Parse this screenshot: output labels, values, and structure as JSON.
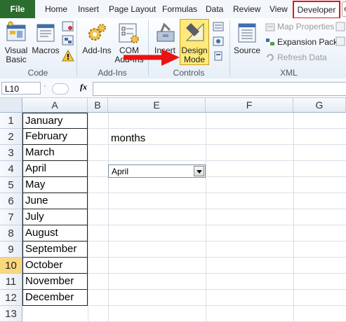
{
  "tabs": {
    "file": "File",
    "home": "Home",
    "insert": "Insert",
    "page_layout": "Page Layout",
    "formulas": "Formulas",
    "data": "Data",
    "review": "Review",
    "view": "View",
    "developer": "Developer",
    "more": "ꞓ"
  },
  "ribbon": {
    "code": {
      "visual_basic_1": "Visual",
      "visual_basic_2": "Basic",
      "macros": "Macros",
      "group": "Code"
    },
    "addins": {
      "addins": "Add-Ins",
      "com_1": "COM",
      "com_2": "Add-Ins",
      "group": "Add-Ins"
    },
    "controls": {
      "insert": "Insert",
      "design_1": "Design",
      "design_2": "Mode",
      "group": "Controls"
    },
    "xml": {
      "source": "Source",
      "map_properties": "Map Properties",
      "expansion_packs": "Expansion Packs",
      "refresh_data": "Refresh Data",
      "group": "XML"
    }
  },
  "formula_bar": {
    "name_box": "L10",
    "fx": "fx",
    "content": ""
  },
  "columns": [
    "A",
    "B",
    "E",
    "F",
    "G"
  ],
  "rows": [
    "1",
    "2",
    "3",
    "4",
    "5",
    "6",
    "7",
    "8",
    "9",
    "10",
    "11",
    "12",
    "13"
  ],
  "selected_row": "10",
  "months": [
    "January",
    "February",
    "March",
    "April",
    "May",
    "June",
    "July",
    "August",
    "September",
    "October",
    "November",
    "December"
  ],
  "label_cell": "months",
  "combo": {
    "value": "April"
  },
  "colors": {
    "file_tab": "#2d6c2f",
    "highlight": "#e11111",
    "design_mode_active": "#ffe97a"
  }
}
